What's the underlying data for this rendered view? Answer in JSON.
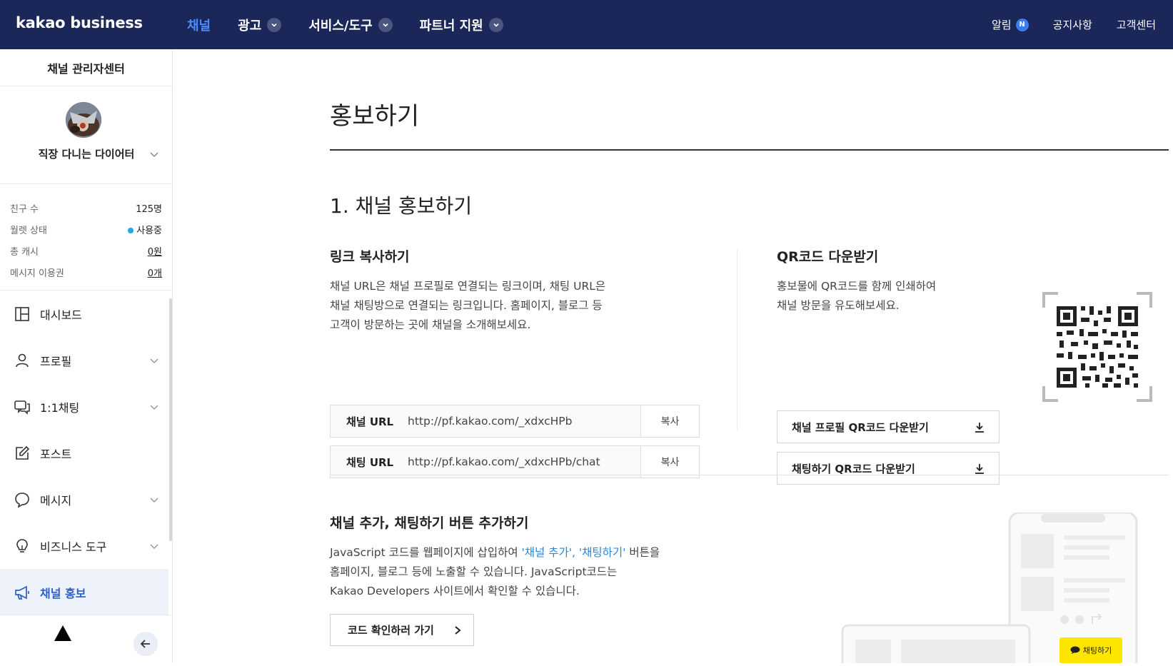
{
  "topbar": {
    "logo": "kakao business",
    "nav": [
      {
        "label": "채널",
        "active": true
      },
      {
        "label": "광고",
        "active": false
      },
      {
        "label": "서비스/도구",
        "active": false
      },
      {
        "label": "파트너 지원",
        "active": false
      }
    ],
    "alarm_label": "알림",
    "alarm_badge": "N",
    "notice_label": "공지사항",
    "support_label": "고객센터"
  },
  "sidebar": {
    "title": "채널 관리자센터",
    "profile_name": "직장 다니는 다이어터",
    "stats": [
      {
        "label": "친구 수",
        "value": "125명"
      },
      {
        "label": "월렛 상태",
        "value": "사용중"
      },
      {
        "label": "총 캐시",
        "value": "0원"
      },
      {
        "label": "메시지 이용권",
        "value": "0개"
      }
    ],
    "menu": [
      {
        "label": "대시보드",
        "icon": "dashboard-icon"
      },
      {
        "label": "프로필",
        "icon": "person-icon"
      },
      {
        "label": "1:1채팅",
        "icon": "chat-bubbles-icon"
      },
      {
        "label": "포스트",
        "icon": "edit-icon"
      },
      {
        "label": "메시지",
        "icon": "message-icon"
      },
      {
        "label": "비즈니스 도구",
        "icon": "lightbulb-icon"
      },
      {
        "label": "채널 홍보",
        "icon": "megaphone-icon"
      }
    ]
  },
  "main": {
    "page_title": "홍보하기",
    "section1_title": "1. 채널 홍보하기",
    "link_copy": {
      "heading": "링크 복사하기",
      "desc_lines": [
        "채널 URL은 채널 프로필로 연결되는 링크이며, 채팅 URL은",
        "채널 채팅방으로 연결되는 링크입니다. 홈페이지, 블로그 등",
        "고객이 방문하는 곳에 채널을 소개해보세요."
      ],
      "rows": [
        {
          "label": "채널 URL",
          "value": "http://pf.kakao.com/_xdxcHPb",
          "button": "복사"
        },
        {
          "label": "채팅 URL",
          "value": "http://pf.kakao.com/_xdxcHPb/chat",
          "button": "복사"
        }
      ]
    },
    "qr": {
      "heading": "QR코드 다운받기",
      "desc_lines": [
        "홍보물에 QR코드를 함께 인쇄하여",
        "채널 방문을 유도해보세요."
      ],
      "buttons": [
        "채널 프로필 QR코드 다운받기",
        "채팅하기 QR코드 다운받기"
      ]
    },
    "section3": {
      "heading": "채널 추가, 채팅하기 버튼 추가하기",
      "line1_pre": "JavaScript 코드를 웹페이지에 삽입하여 ",
      "line1_hl": "'채널 추가', '채팅하기'",
      "line1_post": " 버튼을",
      "line2": "홈페이지, 블로그 등에 노출할 수 있습니다. JavaScript코드는",
      "line3": "Kakao Developers 사이트에서 확인할 수 있습니다.",
      "button": "코드 확인하러 가기"
    },
    "illustration_chat_label": "채팅하기"
  }
}
